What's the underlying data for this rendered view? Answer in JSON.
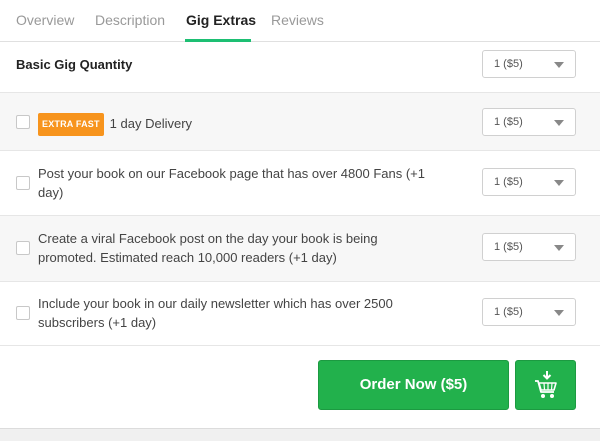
{
  "tabs": [
    {
      "label": "Overview",
      "active": false
    },
    {
      "label": "Description",
      "active": false
    },
    {
      "label": "Gig Extras",
      "active": true
    },
    {
      "label": "Reviews",
      "active": false
    }
  ],
  "basic": {
    "title": "Basic Gig Quantity",
    "select_value": "1 ($5)"
  },
  "extras": [
    {
      "badge": "EXTRA FAST",
      "text": "1 day Delivery",
      "select_value": "1 ($5)"
    },
    {
      "badge": "",
      "text": "Post your book on our Facebook page that has over 4800 Fans (+1 day)",
      "select_value": "1 ($5)"
    },
    {
      "badge": "",
      "text": "Create a viral Facebook post on the day your book is being promoted. Estimated reach 10,000 readers  (+1 day)",
      "select_value": "1 ($5)"
    },
    {
      "badge": "",
      "text": "Include your book in our daily newsletter which has over 2500 subscribers  (+1 day)",
      "select_value": "1 ($5)"
    }
  ],
  "actions": {
    "order_label": "Order Now ($5)",
    "cart_icon": "cart-download-icon"
  },
  "colors": {
    "accent": "#1dbf73",
    "button": "#22b14c",
    "badge": "#f7941d"
  }
}
